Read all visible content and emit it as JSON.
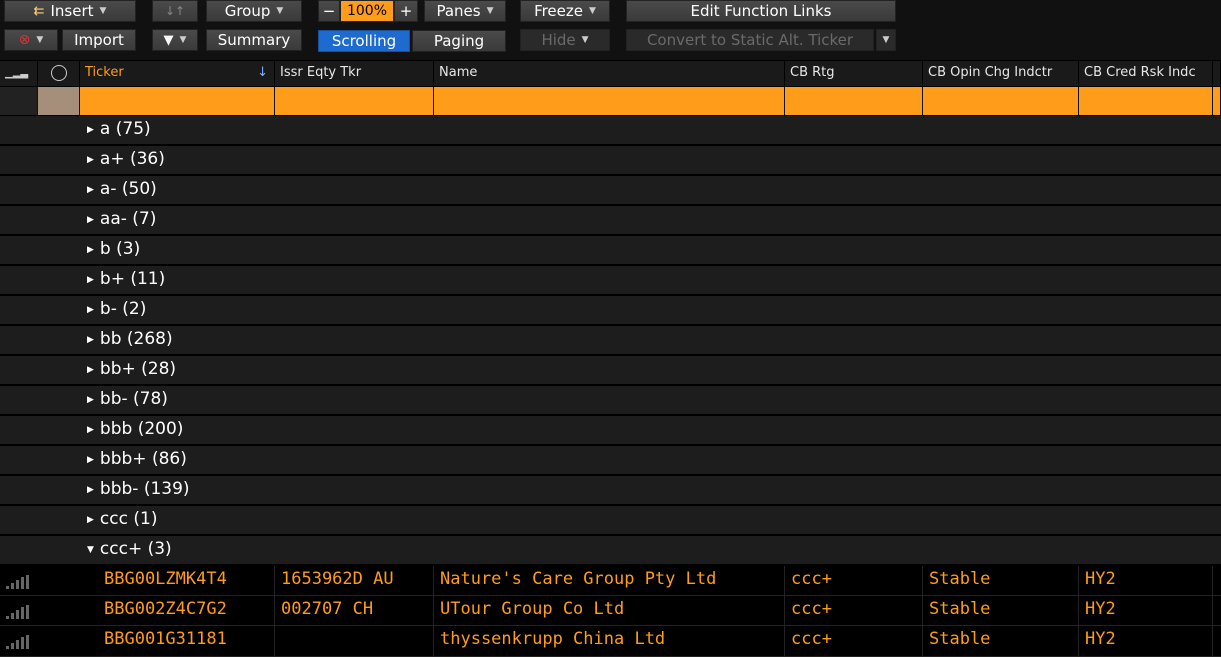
{
  "toolbar": {
    "insert_label": "Insert",
    "group_label": "Group",
    "zoom": "100%",
    "panes_label": "Panes",
    "freeze_label": "Freeze",
    "edit_links_label": "Edit Function Links",
    "import_label": "Import",
    "summary_label": "Summary",
    "scrolling_label": "Scrolling",
    "paging_label": "Paging",
    "hide_label": "Hide",
    "convert_label": "Convert to Static Alt. Ticker"
  },
  "columns": [
    {
      "label": "Ticker",
      "sort": "↓"
    },
    {
      "label": "Issr Eqty Tkr"
    },
    {
      "label": "Name"
    },
    {
      "label": "CB Rtg"
    },
    {
      "label": "CB Opin Chg Indctr"
    },
    {
      "label": "CB Cred Rsk Indc"
    }
  ],
  "groups": [
    {
      "label": "a (75)",
      "expanded": false
    },
    {
      "label": "a+ (36)",
      "expanded": false
    },
    {
      "label": "a- (50)",
      "expanded": false
    },
    {
      "label": "aa- (7)",
      "expanded": false
    },
    {
      "label": "b (3)",
      "expanded": false
    },
    {
      "label": "b+ (11)",
      "expanded": false
    },
    {
      "label": "b- (2)",
      "expanded": false
    },
    {
      "label": "bb (268)",
      "expanded": false
    },
    {
      "label": "bb+ (28)",
      "expanded": false
    },
    {
      "label": "bb- (78)",
      "expanded": false
    },
    {
      "label": "bbb (200)",
      "expanded": false
    },
    {
      "label": "bbb+ (86)",
      "expanded": false
    },
    {
      "label": "bbb- (139)",
      "expanded": false
    },
    {
      "label": "ccc (1)",
      "expanded": false
    },
    {
      "label": "ccc+ (3)",
      "expanded": true
    }
  ],
  "rows": [
    {
      "ticker": "BBG00LZMK4T4",
      "issuer_tkr": "1653962D AU",
      "name": "Nature's Care Group Pty Ltd",
      "rating": "ccc+",
      "opinion": "Stable",
      "risk": "HY2"
    },
    {
      "ticker": "BBG002Z4C7G2",
      "issuer_tkr": "002707 CH",
      "name": "UTour Group Co Ltd",
      "rating": "ccc+",
      "opinion": "Stable",
      "risk": "HY2"
    },
    {
      "ticker": "BBG001G31181",
      "issuer_tkr": "",
      "name": "thyssenkrupp China Ltd",
      "rating": "ccc+",
      "opinion": "Stable",
      "risk": "HY2"
    }
  ],
  "colors": {
    "accent": "#ff9c1a",
    "active": "#1e6bd0"
  }
}
